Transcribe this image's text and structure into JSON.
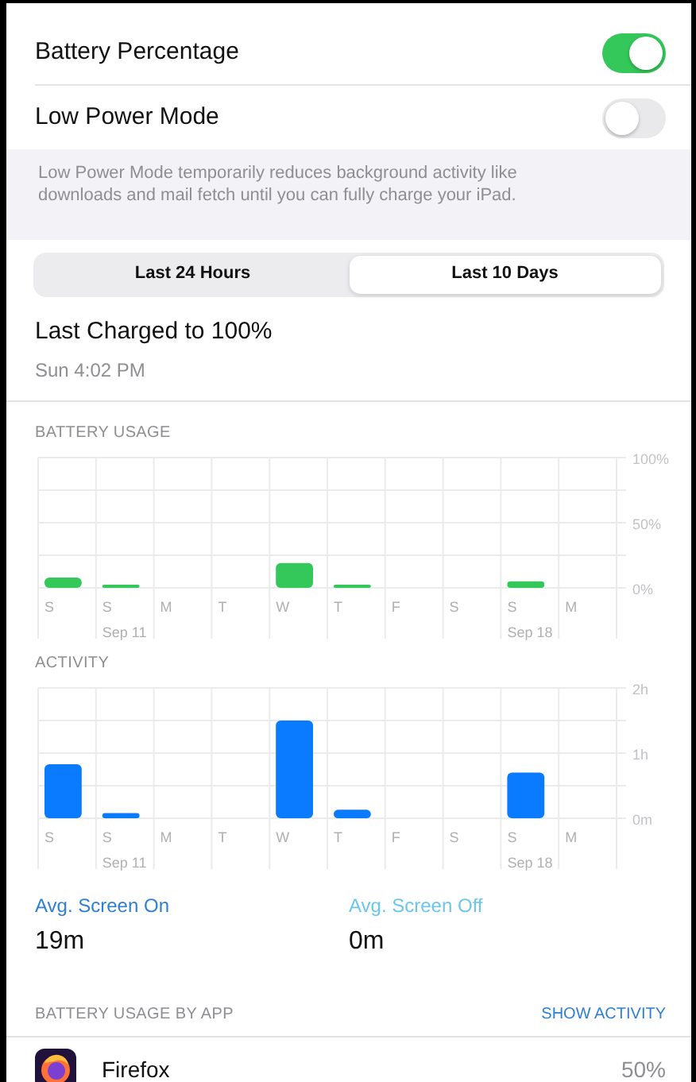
{
  "settings": [
    {
      "label": "Battery Percentage",
      "on": true
    },
    {
      "label": "Low Power Mode",
      "on": false
    }
  ],
  "footnote": "Low Power Mode temporarily reduces background activity like downloads and mail fetch until you can fully charge your iPad.",
  "tabs": [
    {
      "label": "Last 24 Hours",
      "selected": false
    },
    {
      "label": "Last 10 Days",
      "selected": true
    }
  ],
  "last_charged": {
    "title": "Last Charged to 100%",
    "time": "Sun 4:02 PM"
  },
  "battery_usage": {
    "header": "BATTERY USAGE",
    "chart_data": {
      "type": "bar",
      "categories": [
        "S",
        "S",
        "M",
        "T",
        "W",
        "T",
        "F",
        "S",
        "S",
        "M"
      ],
      "series": [
        {
          "color": "#34c759",
          "values": [
            8,
            2,
            0,
            0,
            19,
            2,
            0,
            0,
            5,
            0
          ]
        }
      ],
      "ylim": [
        0,
        100
      ],
      "yticks": [
        {
          "value": 0,
          "label": "0%"
        },
        {
          "value": 50,
          "label": "50%"
        },
        {
          "value": 100,
          "label": "100%"
        }
      ]
    },
    "week_labels": [
      "Sep 11",
      "Sep 18"
    ]
  },
  "activity": {
    "header": "ACTIVITY",
    "chart_data": {
      "type": "bar",
      "categories": [
        "S",
        "S",
        "M",
        "T",
        "W",
        "T",
        "F",
        "S",
        "S",
        "M"
      ],
      "series": [
        {
          "color": "#0a7aff",
          "values": [
            0.83,
            0.08,
            0,
            0,
            1.5,
            0.13,
            0,
            0,
            0.7,
            0
          ]
        }
      ],
      "ylim": [
        0,
        2
      ],
      "yticks": [
        {
          "value": 0,
          "label": "0m"
        },
        {
          "value": 1,
          "label": "1h"
        },
        {
          "value": 2,
          "label": "2h"
        }
      ]
    },
    "week_labels": [
      "Sep 11",
      "Sep 18"
    ]
  },
  "averages": [
    {
      "label": "Avg. Screen On",
      "value": "19m",
      "color": "#2f7fd3"
    },
    {
      "label": "Avg. Screen Off",
      "value": "0m",
      "color": "#6cc6ec"
    }
  ],
  "app_usage": {
    "header": "BATTERY USAGE BY APP",
    "action": "SHOW ACTIVITY",
    "apps": [
      {
        "name": "Firefox",
        "share": "50%"
      }
    ]
  }
}
